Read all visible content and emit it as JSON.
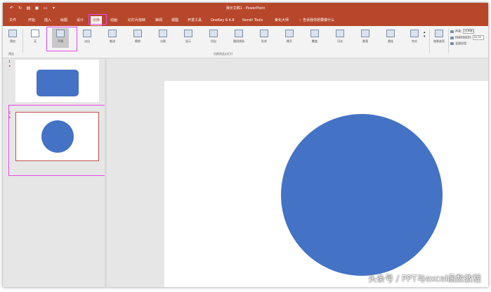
{
  "window": {
    "document_title": "演示文稿1 - PowerPoint",
    "quick_access_icons": [
      "undo-icon",
      "redo-icon",
      "start-from-beginning-icon",
      "save-icon",
      "open-icon",
      "customize-icon"
    ]
  },
  "tabs": [
    {
      "label": "文件"
    },
    {
      "label": "开始"
    },
    {
      "label": "插入"
    },
    {
      "label": "绘图"
    },
    {
      "label": "设计"
    },
    {
      "label": "切换"
    },
    {
      "label": "动画"
    },
    {
      "label": "幻灯片放映"
    },
    {
      "label": "审阅"
    },
    {
      "label": "视图"
    },
    {
      "label": "开发工具"
    },
    {
      "label": "OneKey 6.4.8"
    },
    {
      "label": "Nordri Tools"
    },
    {
      "label": "美化大师"
    },
    {
      "label": "告诉我你想要做什么"
    }
  ],
  "active_tab": "切换",
  "ribbon": {
    "preview_label": "预览",
    "preview_group_label": "预览",
    "transitions_group_label": "切换到此幻灯片",
    "transitions": [
      {
        "label": "无"
      },
      {
        "label": "平滑"
      },
      {
        "label": "淡出"
      },
      {
        "label": "推进"
      },
      {
        "label": "擦除"
      },
      {
        "label": "分割"
      },
      {
        "label": "显示"
      },
      {
        "label": "切出"
      },
      {
        "label": "随机线条"
      },
      {
        "label": "形状"
      },
      {
        "label": "揭开"
      },
      {
        "label": "覆盖"
      },
      {
        "label": "闪光"
      },
      {
        "label": "跌落"
      },
      {
        "label": "悬挂"
      },
      {
        "label": "帘式"
      }
    ],
    "selected_transition": "平滑",
    "effect_options_label": "效果选项",
    "sound_label": "声音:",
    "sound_value": "[无声音]",
    "duration_label": "持续时间(D):",
    "duration_value": "02.00",
    "apply_all_label": "全部应用"
  },
  "slides": [
    {
      "number": "1",
      "star": "★"
    },
    {
      "number": "2",
      "star": "★"
    }
  ],
  "colors": {
    "accent": "#b7472a",
    "shape_fill": "#4472c4",
    "highlight": "#e64be6",
    "selected_slide_border": "#c0504d"
  },
  "watermark": "头条号 / PPT与excel函数教程"
}
